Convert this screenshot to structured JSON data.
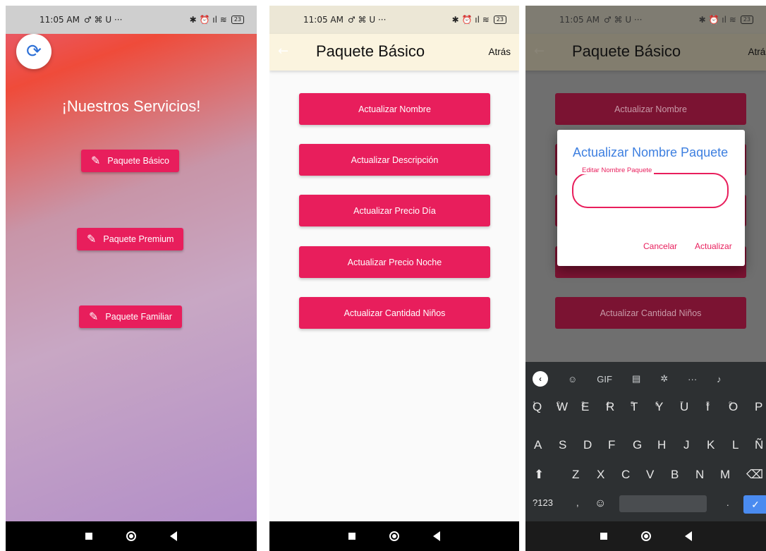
{
  "status": {
    "time": "11:05 AM",
    "left_icons": "♂ ⌘ U ···",
    "right_icons": "✱ ⏰ ıl ≋",
    "battery": "23"
  },
  "phone1": {
    "title": "¡Nuestros Servicios!",
    "buttons": [
      "Paquete Básico",
      "Paquete Premium",
      "Paquete Familiar"
    ],
    "colors": {
      "button": "#e81e5c",
      "gradient_top": "#ef4b3a",
      "gradient_bottom": "#b28ec8"
    }
  },
  "phone2": {
    "appbar_title": "Paquete Básico",
    "back_label": "Atrás",
    "actions": [
      "Actualizar Nombre",
      "Actualizar Descripción",
      "Actualizar Precio Día",
      "Actualizar Precio Noche",
      "Actualizar Cantidad Niños"
    ]
  },
  "phone3": {
    "appbar_title": "Paquete Básico",
    "back_label": "Atrás",
    "actions": [
      "Actualizar Nombre",
      "Actualizar Cantidad Niños"
    ],
    "dialog": {
      "title": "Actualizar Nombre Paquete",
      "field_label": "Editar Nombre Paquete",
      "field_value": "",
      "cancel": "Cancelar",
      "confirm": "Actualizar"
    },
    "keyboard": {
      "toolbar": [
        "GIF"
      ],
      "row1": [
        "Q",
        "W",
        "E",
        "R",
        "T",
        "Y",
        "U",
        "I",
        "O",
        "P"
      ],
      "row1_hints": [
        "1",
        "2",
        "3",
        "4",
        "5",
        "6",
        "7",
        "8",
        "9"
      ],
      "row2": [
        "A",
        "S",
        "D",
        "F",
        "G",
        "H",
        "J",
        "K",
        "L",
        "Ñ"
      ],
      "row3": [
        "Z",
        "X",
        "C",
        "V",
        "B",
        "N",
        "M"
      ],
      "row4_left": "?123",
      "row4_comma": ",",
      "row4_period": "."
    }
  },
  "icons": [
    "refresh-icon",
    "pencil-icon",
    "back-arrow-icon",
    "keyboard-collapse-icon",
    "sticker-icon",
    "clipboard-icon",
    "settings-icon",
    "mic-icon",
    "shift-icon",
    "backspace-icon",
    "emoji-icon",
    "check-icon"
  ]
}
